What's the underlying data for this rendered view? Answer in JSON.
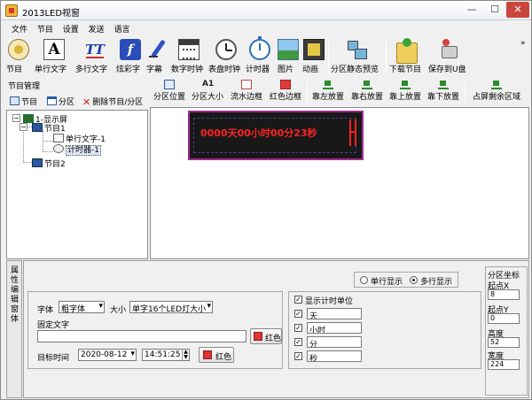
{
  "window": {
    "title": "2013LED视窗",
    "min": "—",
    "max": "☐",
    "close": "✕"
  },
  "menu": [
    "文件",
    "节目",
    "设置",
    "发送",
    "语言"
  ],
  "toolbar": {
    "items": [
      {
        "label": "节目",
        "icon": "program-icon"
      },
      {
        "label": "单行文字",
        "icon": "text-a-icon"
      },
      {
        "label": "多行文字",
        "icon": "multiline-text-icon"
      },
      {
        "label": "炫彩字",
        "icon": "colorful-text-icon"
      },
      {
        "label": "字幕",
        "icon": "subtitle-pen-icon"
      },
      {
        "label": "数字时钟",
        "icon": "digital-clock-icon"
      },
      {
        "label": "表盘时钟",
        "icon": "dial-clock-icon"
      },
      {
        "label": "计时器",
        "icon": "timer-icon"
      },
      {
        "label": "图片",
        "icon": "picture-icon"
      },
      {
        "label": "动画",
        "icon": "animation-icon"
      },
      {
        "label": "分区静态预览",
        "icon": "static-preview-icon"
      },
      {
        "label": "下载节目",
        "icon": "download-program-icon"
      },
      {
        "label": "保存到U盘",
        "icon": "usb-save-icon"
      }
    ],
    "more": "»"
  },
  "program_manager": {
    "title": "节目管理",
    "tools": {
      "program": "节目",
      "partition": "分区",
      "delete": "删除节目/分区",
      "delete_icon": "✕"
    },
    "tree": {
      "screen": "1-显示屏",
      "program1": "节目1",
      "text1": "单行文字-1",
      "timer1": "计时器-1",
      "program2": "节目2"
    }
  },
  "partition_tools": [
    "分区位置",
    "分区大小",
    "流水边框",
    "红色边框",
    "靠左放置",
    "靠右放置",
    "靠上放置",
    "靠下放置",
    "占屏剩余区域"
  ],
  "partition_size_glyph": "A1",
  "led": {
    "text": "0000天00小时00分23秒",
    "color": "#ff2323"
  },
  "props": {
    "side_label": "属性编辑窗体",
    "display": {
      "single": "单行显示",
      "multi": "多行显示"
    },
    "font_label": "字体",
    "font_value": "粗字体",
    "size_label": "大小",
    "size_value": "单字16个LED灯大小",
    "fixed_text_label": "固定文字",
    "fixed_text_value": "",
    "color_label": "红色",
    "target_time_label": "目标时间",
    "date_value": "2020-08-12",
    "time_value": "14:51:25",
    "color2_label": "红色",
    "show_units_label": "显示计时单位",
    "units": [
      "天",
      "小时",
      "分",
      "秒"
    ],
    "coords": {
      "title": "分区坐标",
      "start_x_label": "起点X",
      "start_x": "8",
      "start_y_label": "起点Y",
      "start_y": "0",
      "height_label": "高度",
      "height": "52",
      "width_label": "宽度",
      "width": "224"
    }
  }
}
